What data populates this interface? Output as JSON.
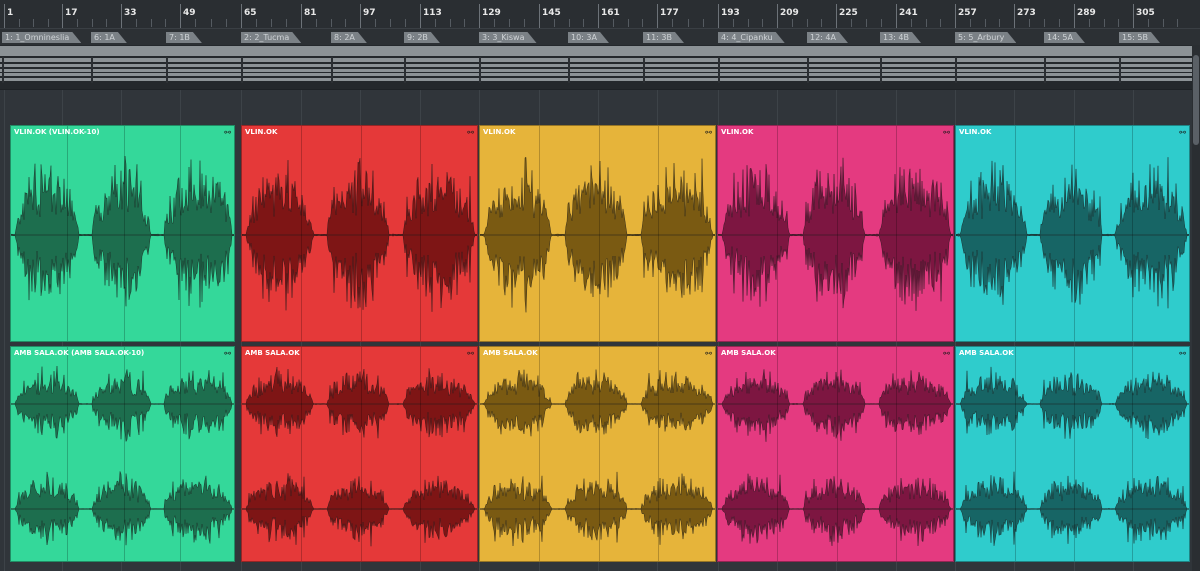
{
  "ruler": {
    "bars": [
      "1",
      "17",
      "33",
      "49",
      "65",
      "81",
      "97",
      "113",
      "129",
      "145",
      "161",
      "177",
      "193",
      "209",
      "225",
      "241",
      "257",
      "273",
      "289",
      "305"
    ]
  },
  "markers": [
    {
      "label": "1: 1_Omnineslia"
    },
    {
      "label": "6: 1A"
    },
    {
      "label": "7: 1B"
    },
    {
      "label": "2: 2_Tucma"
    },
    {
      "label": "8: 2A"
    },
    {
      "label": "9: 2B"
    },
    {
      "label": "3: 3_Kiswa"
    },
    {
      "label": "10: 3A"
    },
    {
      "label": "11: 3B"
    },
    {
      "label": "4: 4_Cipanku"
    },
    {
      "label": "12: 4A"
    },
    {
      "label": "13: 4B"
    },
    {
      "label": "5: 5_Arbury"
    },
    {
      "label": "14: 5A"
    },
    {
      "label": "15: 5B"
    }
  ],
  "tracks": [
    {
      "name": "VLIN.OK",
      "events": [
        {
          "label": "VLIN.OK (VLIN.OK-10)",
          "color": "#34d89a",
          "wave": "#1d6e4e"
        },
        {
          "label": "VLIN.OK",
          "color": "#e53939",
          "wave": "#7e1515"
        },
        {
          "label": "VLIN.OK",
          "color": "#e6b43a",
          "wave": "#7a5a12"
        },
        {
          "label": "VLIN.OK",
          "color": "#e43a80",
          "wave": "#7d1641"
        },
        {
          "label": "VLIN.OK",
          "color": "#2fcccc",
          "wave": "#176565"
        }
      ]
    },
    {
      "name": "AMB SALA.OK",
      "events": [
        {
          "label": "AMB SALA.OK (AMB SALA.OK-10)",
          "color": "#34d89a",
          "wave": "#1d6e4e"
        },
        {
          "label": "AMB SALA.OK",
          "color": "#e53939",
          "wave": "#7e1515"
        },
        {
          "label": "AMB SALA.OK",
          "color": "#e6b43a",
          "wave": "#7a5a12"
        },
        {
          "label": "AMB SALA.OK",
          "color": "#e43a80",
          "wave": "#7d1641"
        },
        {
          "label": "AMB SALA.OK",
          "color": "#2fcccc",
          "wave": "#176565"
        }
      ]
    }
  ],
  "icons": {
    "event_icon": "split-icon"
  },
  "colors": {
    "ruler_bg": "#2a2e32",
    "arranger_bg": "#30353a"
  }
}
